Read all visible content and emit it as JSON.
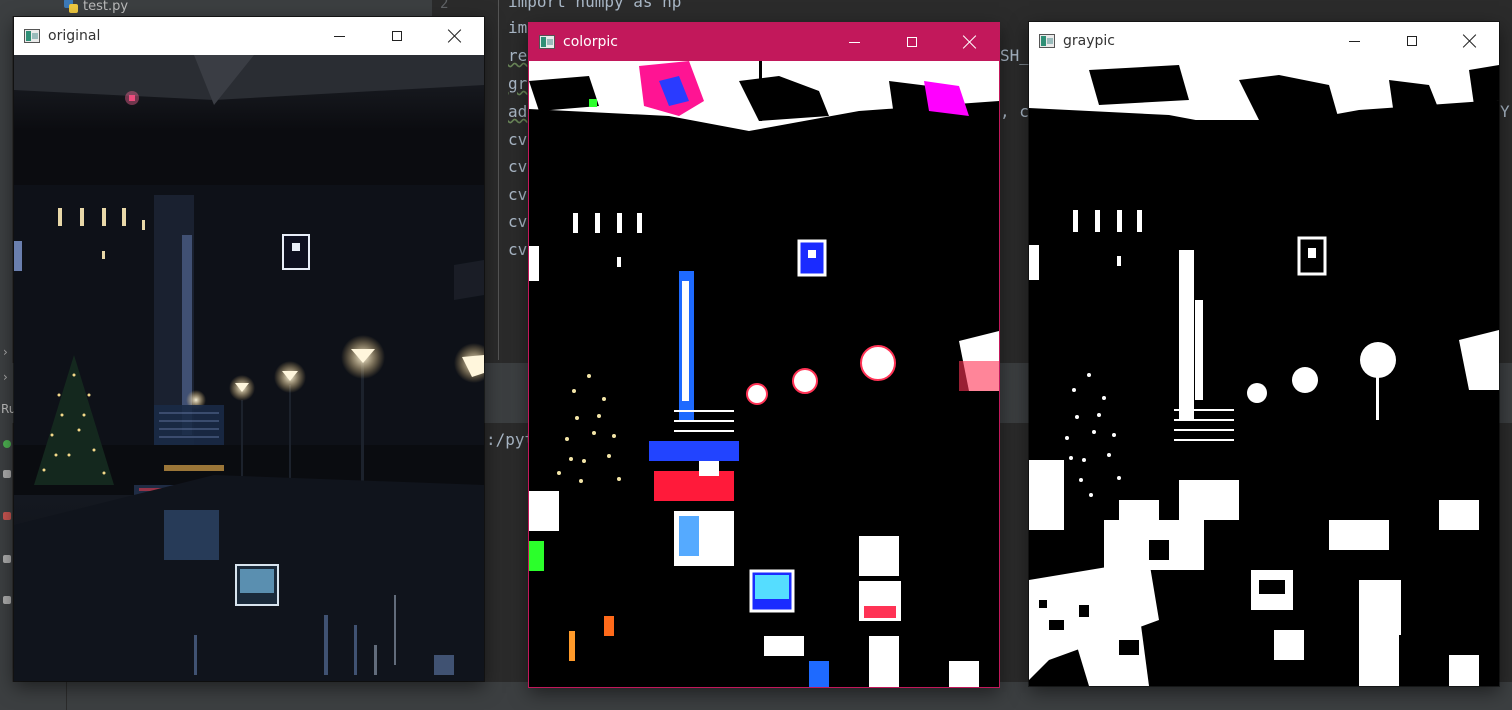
{
  "ide": {
    "file_tab": "test.py",
    "line_number": "2",
    "code_lines": [
      "import numpy as np",
      "im",
      "re",
      "gr",
      "ad",
      "cv",
      "cv",
      "cv",
      "cv",
      "cv"
    ],
    "code_right_1": "SH_",
    "code_right_2": ", c",
    "code_right_3": "Y",
    "run_output": ":/pyt",
    "side_label": "Ru"
  },
  "windows": {
    "original": {
      "title": "original"
    },
    "colorpic": {
      "title": "colorpic"
    },
    "graypic": {
      "title": "graypic"
    }
  },
  "colors": {
    "active_titlebar": "#c2185b",
    "ide_background": "#2b2b2b",
    "ide_panel": "#3c3f41"
  },
  "icons": [
    "app-icon",
    "minimize-icon",
    "maximize-icon",
    "close-icon",
    "python-file-icon"
  ]
}
